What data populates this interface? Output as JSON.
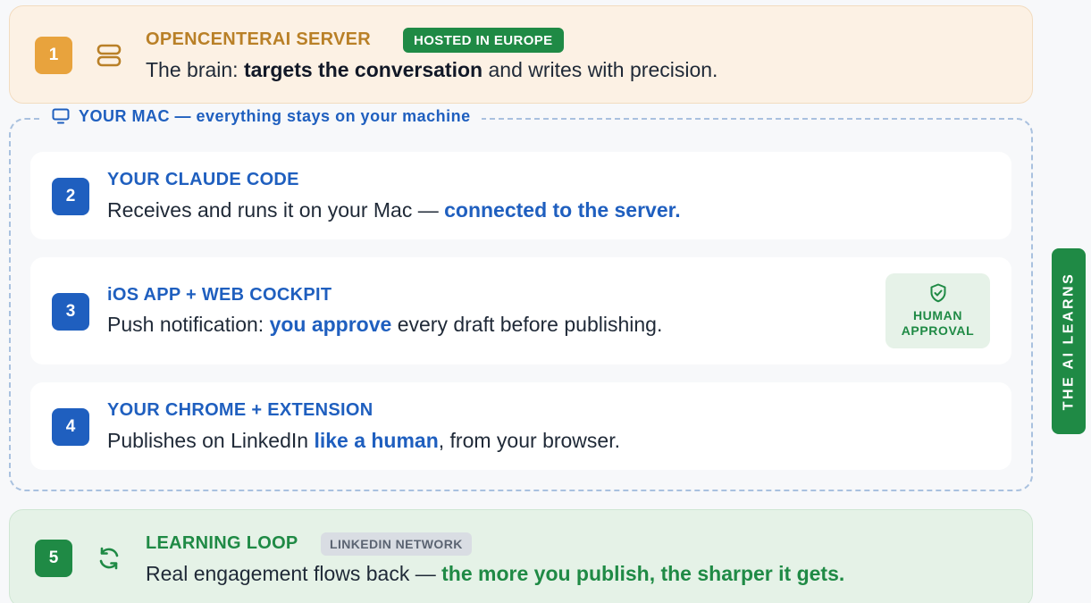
{
  "server": {
    "number": "1",
    "title": "OPENCENTERAI SERVER",
    "badge": "HOSTED IN EUROPE",
    "desc_prefix": "The brain: ",
    "desc_highlight": "targets the conversation",
    "desc_suffix": " and writes with precision.",
    "icon": "server-stack-icon"
  },
  "mac_group": {
    "label": "YOUR MAC — everything stays on your machine",
    "icon": "monitor-icon"
  },
  "steps": [
    {
      "number": "2",
      "title": "YOUR CLAUDE CODE",
      "desc_prefix": "Receives and runs it on your Mac — ",
      "desc_highlight": "connected to the server.",
      "desc_suffix": ""
    },
    {
      "number": "3",
      "title": "iOS APP + WEB COCKPIT",
      "desc_prefix": "Push notification: ",
      "desc_highlight": "you approve",
      "desc_suffix": " every draft before publishing."
    },
    {
      "number": "4",
      "title": "YOUR CHROME + EXTENSION",
      "desc_prefix": "Publishes on LinkedIn ",
      "desc_highlight": "like a human",
      "desc_suffix": ", from your browser."
    }
  ],
  "approval": {
    "line1": "HUMAN",
    "line2": "APPROVAL",
    "icon": "shield-check-icon"
  },
  "learning": {
    "number": "5",
    "title": "LEARNING LOOP",
    "badge": "LINKEDIN NETWORK",
    "desc_prefix": "Real engagement flows back — ",
    "desc_highlight": "the more you publish, the sharper it gets.",
    "icon": "refresh-icon"
  },
  "side_tab": "THE AI LEARNS",
  "colors": {
    "amber": "#e8a33d",
    "blue": "#1f5fbf",
    "green": "#1f8a45"
  }
}
